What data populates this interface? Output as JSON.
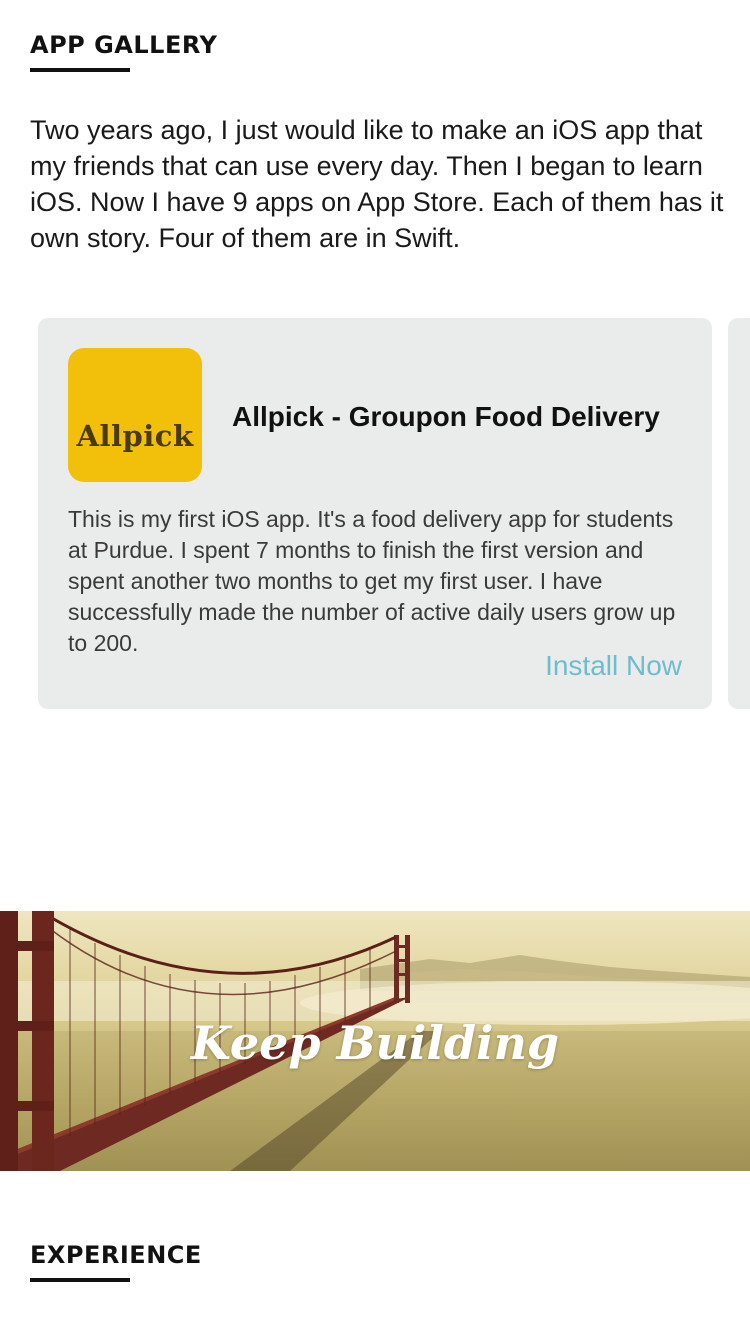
{
  "gallery": {
    "title": "APP GALLERY",
    "intro": "Two years ago, I just would like to make an iOS app that my friends that can use every day. Then I began to learn iOS. Now I have 9 apps on App Store. Each of them has it own story. Four of them are in Swift."
  },
  "apps": [
    {
      "icon_text": "Allpick",
      "icon_color": "#f2bf0a",
      "name": "Allpick - Groupon Food Delivery",
      "description": "This is my first iOS app. It's a food delivery app for students at Purdue. I spent 7 months to finish the first version and spent another two months to get my first user. I have successfully made the number of active daily users grow up to 200.",
      "install_label": "Install Now"
    }
  ],
  "banner": {
    "text": "Keep Building"
  },
  "experience": {
    "title": "EXPERIENCE"
  },
  "colors": {
    "card_background": "#eaeceb",
    "link": "#6fbccd",
    "text": "#111111"
  }
}
